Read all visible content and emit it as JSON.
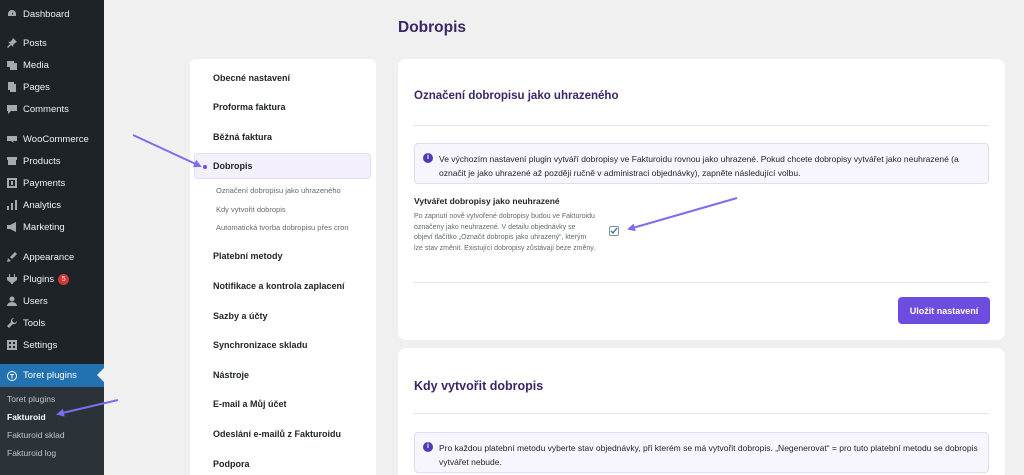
{
  "sidebar": {
    "items": [
      {
        "label": "Dashboard",
        "icon": "dashboard-icon"
      },
      {
        "label": "Posts",
        "icon": "pin-icon"
      },
      {
        "label": "Media",
        "icon": "media-icon"
      },
      {
        "label": "Pages",
        "icon": "pages-icon"
      },
      {
        "label": "Comments",
        "icon": "comments-icon"
      },
      {
        "label": "WooCommerce",
        "icon": "woocommerce-icon"
      },
      {
        "label": "Products",
        "icon": "products-icon"
      },
      {
        "label": "Payments",
        "icon": "payments-icon"
      },
      {
        "label": "Analytics",
        "icon": "analytics-icon"
      },
      {
        "label": "Marketing",
        "icon": "marketing-icon"
      },
      {
        "label": "Appearance",
        "icon": "appearance-icon"
      },
      {
        "label": "Plugins",
        "icon": "plugins-icon",
        "badge": "5"
      },
      {
        "label": "Users",
        "icon": "users-icon"
      },
      {
        "label": "Tools",
        "icon": "tools-icon"
      },
      {
        "label": "Settings",
        "icon": "settings-icon"
      },
      {
        "label": "Toret plugins",
        "icon": "toret-icon"
      }
    ],
    "submenu": [
      "Toret plugins",
      "Fakturoid",
      "Fakturoid sklad",
      "Fakturoid log"
    ]
  },
  "page": {
    "title": "Dobropis"
  },
  "nav": {
    "items": [
      "Obecné nastavení",
      "Proforma faktura",
      "Běžná faktura",
      "Dobropis",
      "Platební metody",
      "Notifikace a kontrola zaplacení",
      "Sazby a účty",
      "Synchronizace skladu",
      "Nástroje",
      "E-mail a Můj účet",
      "Odeslání e-mailů z Fakturoidu",
      "Podpora"
    ],
    "subitems": [
      "Označení dobropisu jako uhrazeného",
      "Kdy vytvořit dobropis",
      "Automatická tvorba dobropisu přes cron"
    ]
  },
  "card1": {
    "title": "Označení dobropisu jako uhrazeného",
    "info": "Ve výchozím nastavení plugin vytváří dobropisy ve Fakturoidu rovnou jako uhrazené. Pokud chcete dobropisy vytvářet jako neuhrazené (a označit je jako uhrazené až později ručně v administraci objednávky), zapněte následující volbu.",
    "field_label": "Vytvářet dobropisy jako neuhrazené",
    "field_desc": "Po zapnutí nově vytvořené dobropisy budou ve Fakturoidu označeny jako neuhrazené. V detailu objednávky se objeví tlačítko „Označit dobropis jako uhrazený“, kterým lze stav změnit. Existující dobropisy zůstávají beze změny.",
    "checked": true,
    "save_label": "Uložit nastavení"
  },
  "card2": {
    "title": "Kdy vytvořit dobropis",
    "info": "Pro každou platební metodu vyberte stav objednávky, při kterém se má vytvořit dobropis. „Negenerovat“ = pro tuto platební metodu se dobropis vytvářet nebude."
  },
  "colors": {
    "accent": "#6c4de0",
    "title": "#3c2668",
    "wp_sidebar": "#1d2327",
    "wp_active": "#2271b1",
    "arrow": "#7b6cf0"
  }
}
